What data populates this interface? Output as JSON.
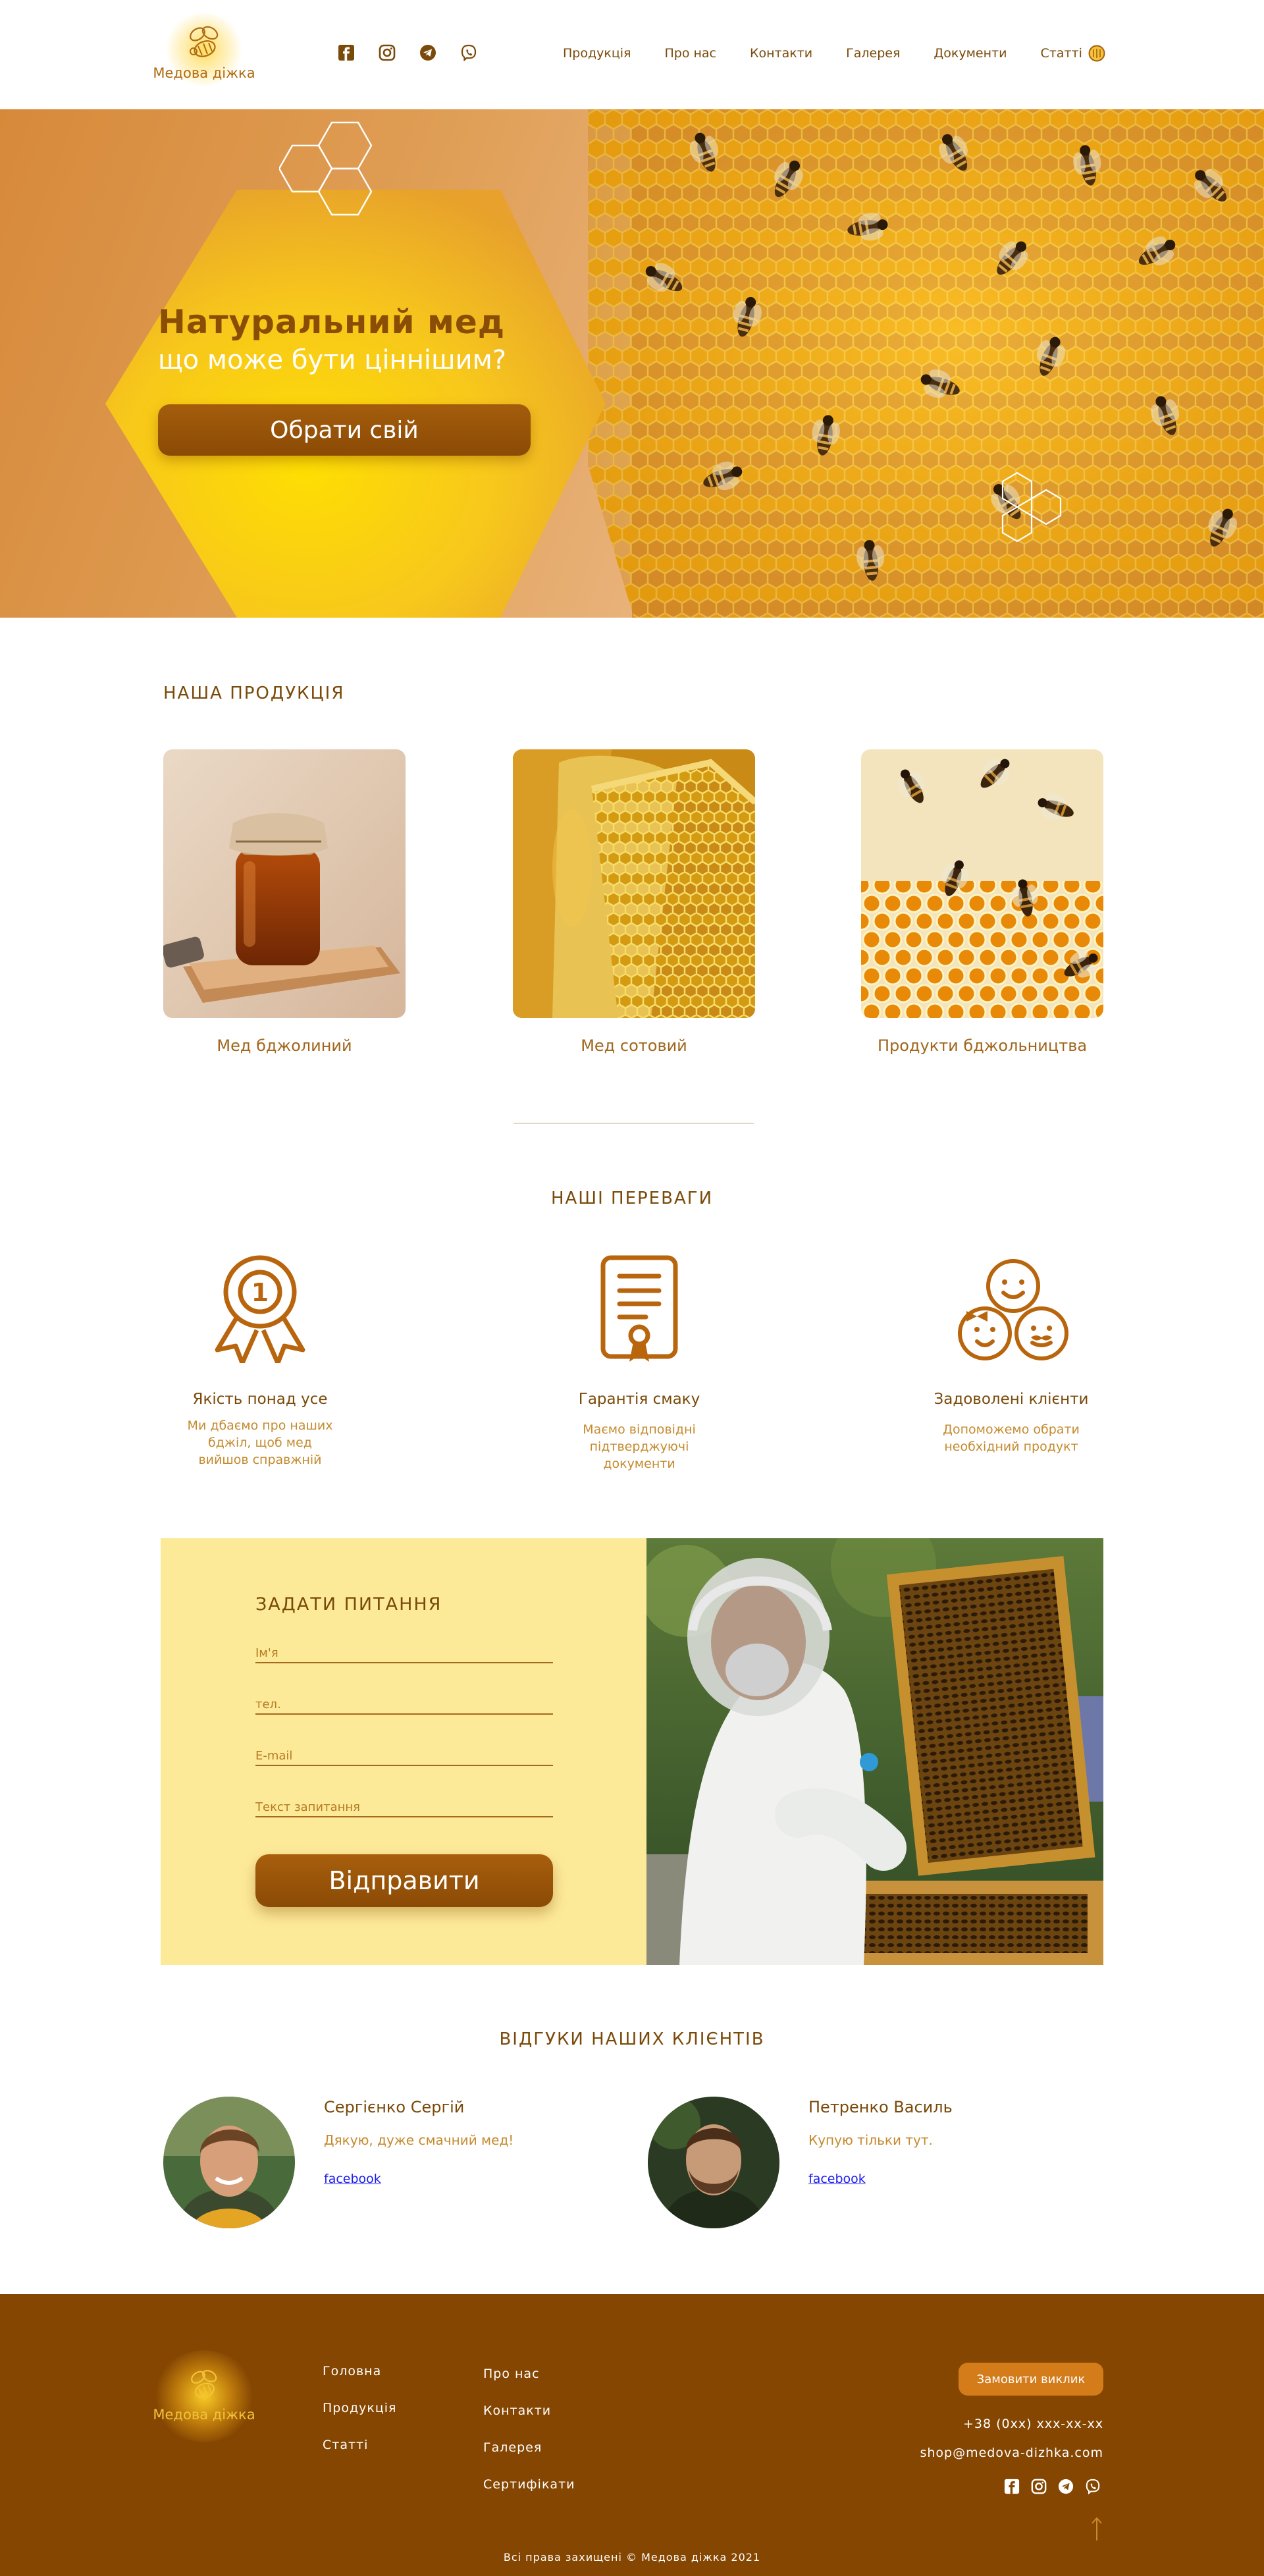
{
  "brand": {
    "name": "Медова діжка"
  },
  "nav": {
    "items": [
      "Продукція",
      "Про нас",
      "Контакти",
      "Галерея",
      "Документи",
      "Статті"
    ]
  },
  "hero": {
    "title": "Натуральний мед",
    "subtitle": "що може бути ціннішим?",
    "button": "Обрати свій"
  },
  "products": {
    "title": "НАША ПРОДУКЦІЯ",
    "items": [
      {
        "label": "Мед бджолиний"
      },
      {
        "label": "Мед сотовий"
      },
      {
        "label": "Продукти бджольництва"
      }
    ]
  },
  "advantages": {
    "title": "НАШІ ПЕРЕВАГИ",
    "items": [
      {
        "title": "Якість понад усе",
        "lines": [
          "Ми дбаємо про наших",
          "бджіл, щоб мед",
          "вийшов справжній"
        ]
      },
      {
        "title": "Гарантія смаку",
        "lines": [
          "Маємо відповідні",
          "підтверджуючі",
          "документи"
        ]
      },
      {
        "title": "Задоволені клієнти",
        "lines": [
          "Допоможемо обрати",
          "необхідний продукт"
        ]
      }
    ]
  },
  "form": {
    "title": "ЗАДАТИ ПИТАННЯ",
    "name_placeholder": "Ім'я",
    "phone_placeholder": "тел.",
    "email_placeholder": "E-mail",
    "question_placeholder": "Текст запитання",
    "submit": "Відправити"
  },
  "reviews": {
    "title": "ВІДГУКИ НАШИХ КЛІЄНТІВ",
    "items": [
      {
        "name": "Сергієнко Сергій",
        "text": "Дякую, дуже смачний мед!",
        "link": "facebook"
      },
      {
        "name": "Петренко Василь",
        "text": "Купую тільки тут.",
        "link": "facebook"
      }
    ]
  },
  "footer": {
    "col1": [
      "Головна",
      "Продукція",
      "Статті"
    ],
    "col2": [
      "Про нас",
      "Контакти",
      "Галерея",
      "Сертифікати"
    ],
    "call_button": "Замовити виклик",
    "phone": "+38 (0xx) xxx-xx-xx",
    "email": "shop@medova-dizhka.com",
    "copyright": "Всі права захищені © Медова діжка 2021"
  },
  "colors": {
    "brown": "#854602",
    "amber": "#d47b1a",
    "honey_yellow": "#fdea98",
    "text_gold": "#c48a2e"
  },
  "icons": [
    "facebook-icon",
    "instagram-icon",
    "telegram-icon",
    "viber-icon",
    "language-flag-icon",
    "medal-icon",
    "certificate-icon",
    "family-icon",
    "arrow-up-icon"
  ]
}
